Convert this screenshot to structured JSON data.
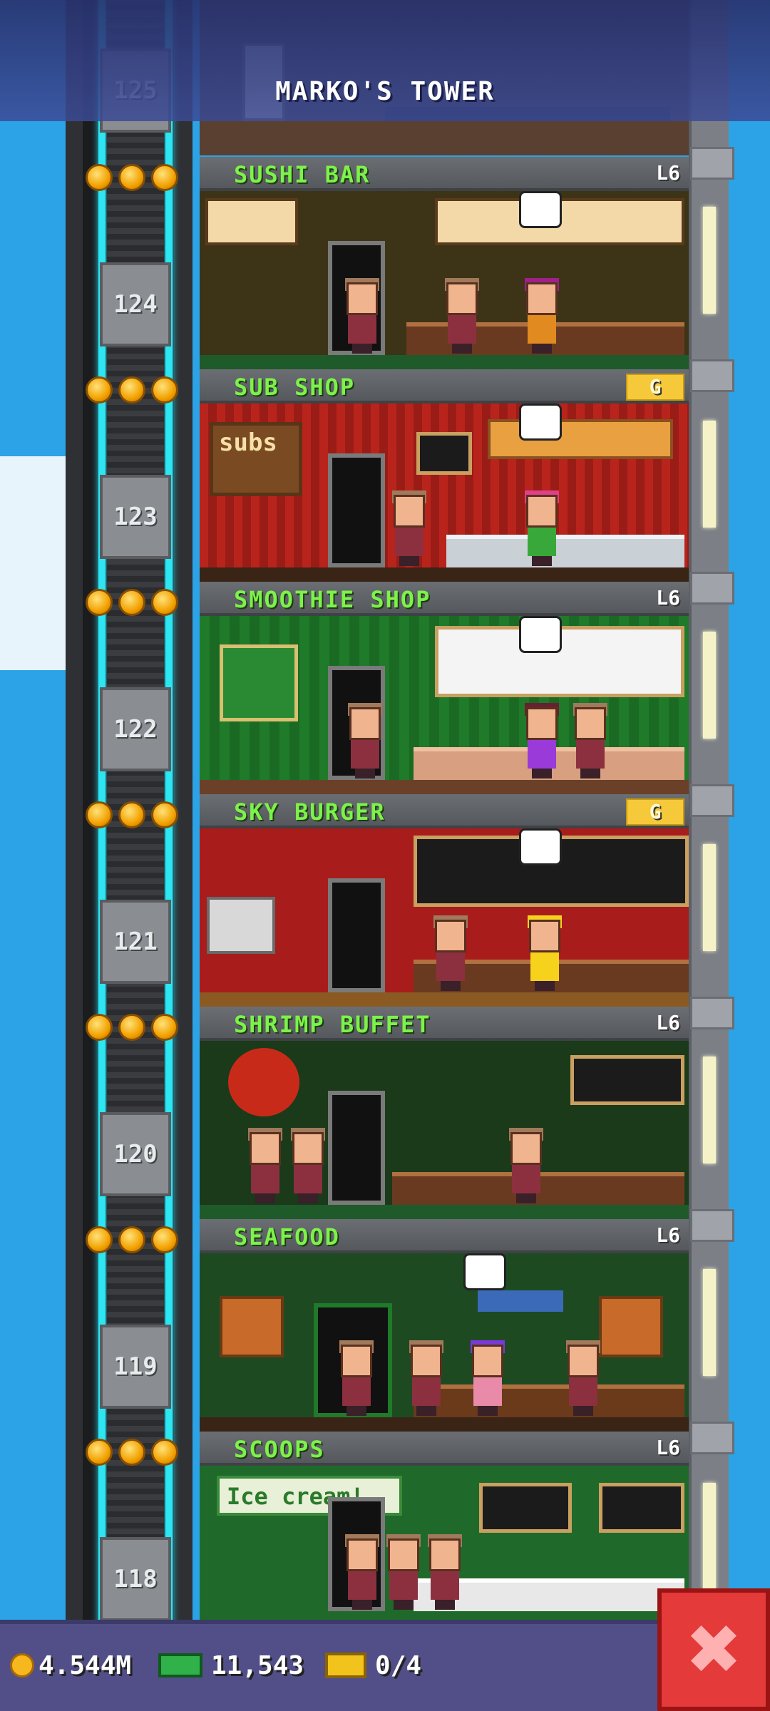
{
  "tower": {
    "title": "MARKO'S TOWER"
  },
  "floors": [
    {
      "number": "125",
      "name": "",
      "level": ""
    },
    {
      "number": "124",
      "name": "SUSHI BAR",
      "level": "L6",
      "level_style": "text"
    },
    {
      "number": "123",
      "name": "SUB SHOP",
      "level": "G",
      "level_style": "gold"
    },
    {
      "number": "122",
      "name": "SMOOTHIE SHOP",
      "level": "L6",
      "level_style": "text"
    },
    {
      "number": "121",
      "name": "SKY BURGER",
      "level": "G",
      "level_style": "gold"
    },
    {
      "number": "120",
      "name": "SHRIMP BUFFET",
      "level": "L6",
      "level_style": "text"
    },
    {
      "number": "119",
      "name": "SEAFOOD",
      "level": "L6",
      "level_style": "text"
    },
    {
      "number": "118",
      "name": "SCOOPS",
      "level": "L6",
      "level_style": "text"
    }
  ],
  "signs": {
    "subs": "subs",
    "ice_cream": "Ice cream!"
  },
  "status_bar": {
    "coins": "4.544M",
    "cash": "11,543",
    "bux": "0/4"
  },
  "icons": {
    "close": "close-icon",
    "coin": "coin-icon",
    "cash": "cash-icon",
    "bux": "bux-icon"
  },
  "colors": {
    "sky": "#2ba3e6",
    "floor_name": "#7cf24a",
    "close_button": "#e43a3a",
    "elevator_rail": "#2ee6f2"
  }
}
